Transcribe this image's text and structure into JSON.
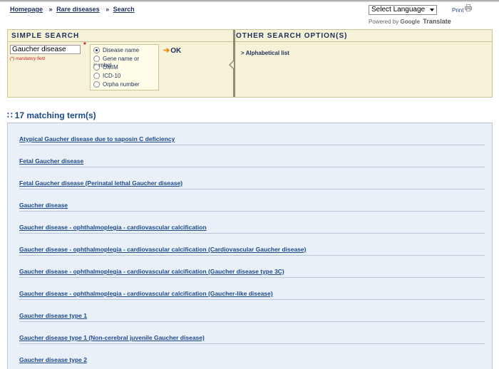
{
  "breadcrumb": [
    {
      "label": "Homepage"
    },
    {
      "label": "Rare diseases"
    },
    {
      "label": "Search"
    }
  ],
  "breadcrumb_sep": "»",
  "language": {
    "selected": "Select Language",
    "powered_by": "Powered by",
    "google": "Google",
    "translate": "Translate"
  },
  "print_label": "Print",
  "simple_search": {
    "title": "SIMPLE SEARCH",
    "input_value": "Gaucher disease",
    "required_mark": "*",
    "mandatory_note": "(*) mandatory field",
    "options": [
      {
        "label": "Disease name",
        "checked": true
      },
      {
        "label": "Gene name or symbol",
        "checked": false
      },
      {
        "label": "OMIM",
        "checked": false
      },
      {
        "label": "ICD-10",
        "checked": false
      },
      {
        "label": "Orpha number",
        "checked": false
      }
    ],
    "ok_label": "OK"
  },
  "other_search": {
    "title": "OTHER SEARCH OPTION(S)",
    "link": "> Alphabetical list"
  },
  "results": {
    "count_label": "17 matching term(s)",
    "items": [
      "Atypical Gaucher disease due to saposin C deficiency",
      "Fetal Gaucher disease",
      "Fetal Gaucher disease (Perinatal lethal Gaucher disease)",
      "Gaucher disease",
      "Gaucher disease - ophthalmoplegia - cardiovascular calcification",
      "Gaucher disease - ophthalmoplegia - cardiovascular calcification (Cardiovascular Gaucher disease)",
      "Gaucher disease - ophthalmoplegia - cardiovascular calcification (Gaucher disease type 3C)",
      "Gaucher disease - ophthalmoplegia - cardiovascular calcification (Gaucher-like disease)",
      "Gaucher disease type 1",
      "Gaucher disease type 1 (Non-cerebral juvenile Gaucher disease)",
      "Gaucher disease type 2"
    ]
  },
  "colors": {
    "panel_bg": "#f5f2d7",
    "results_bg": "#eaf0f8",
    "link": "#1c4a8a",
    "accent": "#f08a00"
  }
}
